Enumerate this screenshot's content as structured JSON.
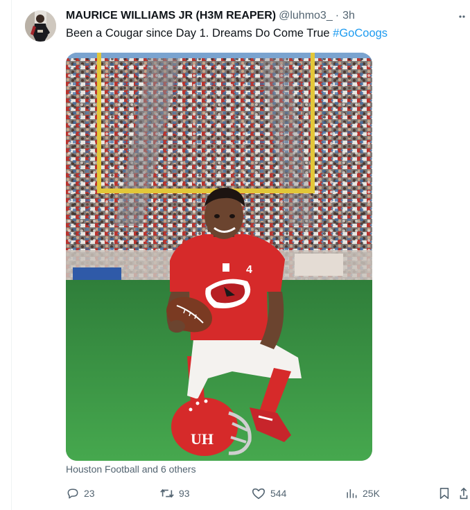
{
  "tweet": {
    "author_name": "MAURICE WILLIAMS JR (H3M REAPER)",
    "handle": "@luhmo3_",
    "separator": "·",
    "time": "3h",
    "text_main": "Been a Cougar since Day 1. Dreams Do Come True ",
    "hashtag": "#GoCoogs",
    "media_alt": "Young football player in red Houston Cougars uniform kneeling with a football and helmet in front of a stadium crowd backdrop",
    "helmet_logo_text": "UH",
    "jersey_number": "4",
    "tagged_text": "Houston Football and 6 others"
  },
  "actions": {
    "reply_count": "23",
    "retweet_count": "93",
    "like_count": "544",
    "views_count": "25K"
  },
  "icons": {
    "more": "more-icon",
    "reply": "reply-icon",
    "retweet": "retweet-icon",
    "like": "heart-icon",
    "views": "views-icon",
    "bookmark": "bookmark-icon",
    "share": "share-icon"
  },
  "colors": {
    "text_primary": "#0f1419",
    "text_secondary": "#536471",
    "link": "#1d9bf0",
    "jersey_red": "#d62a2a",
    "turf_green": "#3d9a45"
  }
}
